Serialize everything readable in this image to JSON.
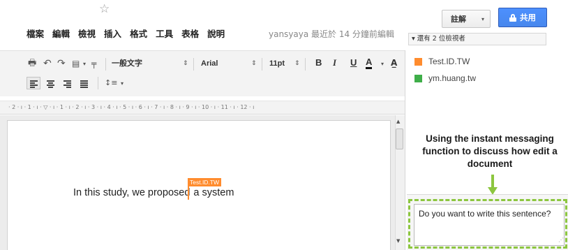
{
  "header": {
    "star_icon": "☆",
    "menu": [
      "檔案",
      "編輯",
      "檢視",
      "插入",
      "格式",
      "工具",
      "表格",
      "說明"
    ],
    "last_edit": "yansyaya 最近於 14 分鐘前編輯",
    "comment_button": "註解",
    "share_button": "共用",
    "viewers": "▾ 還有 2 位檢視者",
    "colors": {
      "share_blue": "#4d90fe"
    }
  },
  "toolbar": {
    "print_icon": "🖶",
    "undo_icon": "↶",
    "redo_icon": "↷",
    "paste_icon": "▤",
    "paint_icon": "╤",
    "dropdown_caret": "▾",
    "style": "一般文字",
    "font": "Arial",
    "size": "11pt",
    "select_arrows": "⇕",
    "bold": "B",
    "italic": "I",
    "underline": "U",
    "text_color": "A",
    "highlight_icon": "A̲",
    "line_spacing_icon": "↕≡"
  },
  "ruler": {
    "marks": "· 2 · ı · 1 · ı · ▽ · ı · 1 · ı · 2 · ı · 3 · ı · 4 · ı · 5 · ı · 6 · ı · 7 · ı · 8 · ı · 9 · ı · 10 · ı · 11 · ı · 12 · ı"
  },
  "document": {
    "text_before_cursor": "In this study, we proposed",
    "text_after_cursor": "a system",
    "cursor_user_flag": "Test.ID.TW",
    "cursor_color": "#ff8c2e"
  },
  "scrollbar": {
    "up_arrow": "▲",
    "down_arrow": "▼"
  },
  "chat": {
    "users": [
      {
        "name": "Test.ID.TW",
        "color": "#ff8c2e"
      },
      {
        "name": "ym.huang.tw",
        "color": "#3fae49"
      }
    ],
    "annotation": "Using the instant messaging function to discuss how edit a document",
    "message_input": "Do you want to write this sentence?",
    "resize_grip": "⋰",
    "highlight_color": "#8cc63f"
  }
}
